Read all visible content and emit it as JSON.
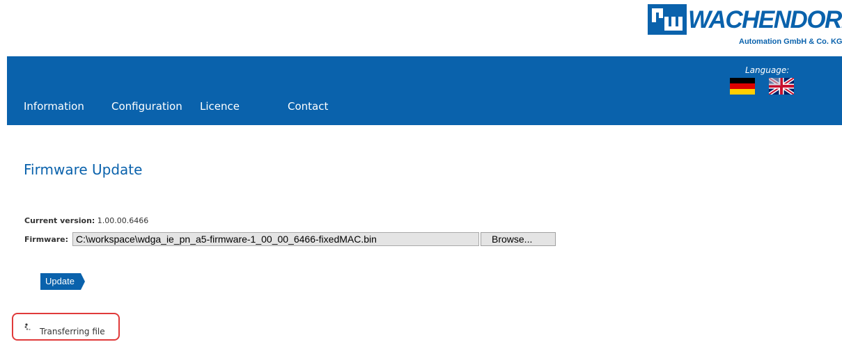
{
  "brand": {
    "name": "WACHENDORFF",
    "subtitle": "Automation GmbH & Co. KG",
    "colors": {
      "primary": "#0a62ac",
      "highlight": "#e03a3a"
    }
  },
  "nav": {
    "items": [
      {
        "label": "Information"
      },
      {
        "label": "Configuration"
      },
      {
        "label": "Licence"
      },
      {
        "label": "Contact"
      }
    ],
    "language_label": "Language:",
    "flags": [
      {
        "icon": "german-flag-icon"
      },
      {
        "icon": "uk-flag-icon"
      }
    ]
  },
  "page": {
    "title": "Firmware Update"
  },
  "form": {
    "version_label": "Current version:",
    "version_value": "1.00.00.6466",
    "firmware_label": "Firmware:",
    "firmware_value": "C:\\workspace\\wdga_ie_pn_a5-firmware-1_00_00_6466-fixedMAC.bin",
    "browse_label": "Browse...",
    "update_label": "Update"
  },
  "status": {
    "text": "Transferring file",
    "icon": "spinner-icon"
  }
}
